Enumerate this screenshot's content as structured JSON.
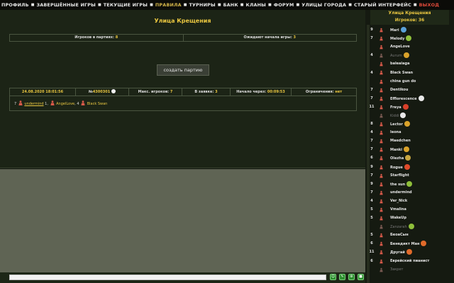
{
  "nav": {
    "items": [
      {
        "label": "ПРОФИЛЬ",
        "style": "normal"
      },
      {
        "label": "ЗАВЕРШЁННЫЕ ИГРЫ",
        "style": "normal"
      },
      {
        "label": "ТЕКУЩИЕ ИГРЫ",
        "style": "normal"
      },
      {
        "label": "ПРАВИЛА",
        "style": "highlight"
      },
      {
        "label": "ТУРНИРЫ",
        "style": "normal"
      },
      {
        "label": "БАНК",
        "style": "normal"
      },
      {
        "label": "КЛАНЫ",
        "style": "normal"
      },
      {
        "label": "ФОРУМ",
        "style": "normal"
      },
      {
        "label": "УЛИЦЫ ГОРОДА",
        "style": "normal"
      },
      {
        "label": "СТАРЫЙ ИНТЕРФЕЙС",
        "style": "normal"
      },
      {
        "label": "ВЫХОД",
        "style": "exit"
      }
    ]
  },
  "main": {
    "title": "Улица Крещения",
    "stats": {
      "in_games_label": "Игроков в партиях:",
      "in_games_value": "8",
      "waiting_label": "Ожидают начала игры:",
      "waiting_value": "3"
    },
    "create_button": "создать партию"
  },
  "game": {
    "date": "24.08.2020 18:01:56",
    "number_prefix": "№",
    "number": "4300301",
    "max_label": "Макс. игроков:",
    "max_value": "7",
    "queue_label": "В заявке:",
    "queue_value": "3",
    "start_label": "Начало через:",
    "start_value": "00:09:53",
    "limit_label": "Ограничения:",
    "limit_value": "нет",
    "players": [
      {
        "level": "7",
        "name": "undermind",
        "count": "1",
        "underline": true
      },
      {
        "level": "",
        "name": "AngelLove",
        "count": "4",
        "underline": false
      },
      {
        "level": "",
        "name": "Black Swan",
        "count": "",
        "underline": false
      }
    ]
  },
  "sidebar": {
    "title": "Улица Крещения",
    "count_label": "Игроков: 36",
    "players": [
      {
        "level": "9",
        "name": "Mari",
        "badge": "#5aa0d8",
        "dim": false
      },
      {
        "level": "7",
        "name": "Melody",
        "badge": "#8fbf3a",
        "dim": false
      },
      {
        "level": "",
        "name": "AngeLove",
        "badge": "",
        "dim": false
      },
      {
        "level": "4",
        "name": "Aurum",
        "badge": "#d9a22a",
        "dim": true
      },
      {
        "level": "",
        "name": "baleaiaga",
        "badge": "",
        "dim": false
      },
      {
        "level": "4",
        "name": "Black Swan",
        "badge": "",
        "dim": false
      },
      {
        "level": "",
        "name": "china gun do",
        "badge": "",
        "dim": false
      },
      {
        "level": "7",
        "name": "Dentikou",
        "badge": "",
        "dim": false
      },
      {
        "level": "7",
        "name": "Efflorescence",
        "badge": "#e8e8e8",
        "dim": false
      },
      {
        "level": "11",
        "name": "Freya",
        "badge": "#d8402a",
        "dim": false
      },
      {
        "level": "",
        "name": "Kiddi",
        "badge": "#e8e8e8",
        "dim": true
      },
      {
        "level": "8",
        "name": "Lector",
        "badge": "#d9a22a",
        "dim": false
      },
      {
        "level": "4",
        "name": "leona",
        "badge": "",
        "dim": false
      },
      {
        "level": "7",
        "name": "Maedchen",
        "badge": "",
        "dim": false
      },
      {
        "level": "7",
        "name": "Manki",
        "badge": "#d9a22a",
        "dim": false
      },
      {
        "level": "6",
        "name": "Olezha",
        "badge": "#c8a640",
        "dim": false
      },
      {
        "level": "9",
        "name": "Rogue",
        "badge": "#e04a2a",
        "dim": false
      },
      {
        "level": "7",
        "name": "Starflight",
        "badge": "",
        "dim": false
      },
      {
        "level": "9",
        "name": "the sun",
        "badge": "#8fbf3a",
        "dim": false
      },
      {
        "level": "7",
        "name": "undermind",
        "badge": "",
        "dim": false
      },
      {
        "level": "4",
        "name": "Ver_Nick",
        "badge": "",
        "dim": false
      },
      {
        "level": "5",
        "name": "Vmalina",
        "badge": "",
        "dim": false
      },
      {
        "level": "5",
        "name": "WakeUp",
        "badge": "",
        "dim": false
      },
      {
        "level": "",
        "name": "Zanzarah",
        "badge": "#8fbf3a",
        "dim": true
      },
      {
        "level": "5",
        "name": "БеоаСын",
        "badge": "",
        "dim": false
      },
      {
        "level": "6",
        "name": "Бенедикт Ман",
        "badge": "#e06a2a",
        "dim": false
      },
      {
        "level": "11",
        "name": "Другай",
        "badge": "#e06a2a",
        "dim": false
      },
      {
        "level": "6",
        "name": "Еврейский пианист",
        "badge": "",
        "dim": false
      },
      {
        "level": "",
        "name": "Закрет",
        "badge": "",
        "dim": true
      }
    ]
  },
  "colors": {
    "accent": "#e9c640",
    "exit": "#e04a3a",
    "panel": "#1c2416",
    "chat_bg": "#5f6454"
  }
}
